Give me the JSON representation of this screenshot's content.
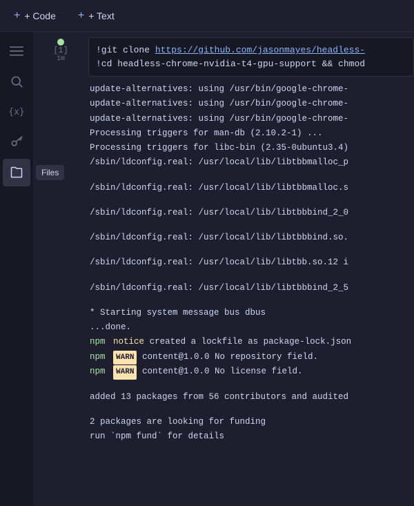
{
  "toolbar": {
    "code_btn": "+ Code",
    "text_btn": "+ Text"
  },
  "sidebar": {
    "icons": [
      {
        "name": "menu-icon",
        "label": "Menu",
        "symbol": "☰",
        "active": false
      },
      {
        "name": "search-icon",
        "label": "Search",
        "symbol": "🔍",
        "active": false
      },
      {
        "name": "variables-icon",
        "label": "Variables",
        "symbol": "{x}",
        "active": false
      },
      {
        "name": "secrets-icon",
        "label": "Secrets",
        "symbol": "🔑",
        "active": false
      },
      {
        "name": "files-icon",
        "label": "Files",
        "symbol": "📁",
        "active": true,
        "tooltip": "Files"
      }
    ]
  },
  "cell": {
    "number": "[1]",
    "time": "1m",
    "run_dot_color": "#a6e3a1",
    "input_lines": [
      "!git clone https://github.com/jasonmayes/headless-",
      "!cd headless-chrome-nvidia-t4-gpu-support && chmod"
    ],
    "link_text": "https://github.com/jasonmayes/headless-",
    "output_lines": [
      {
        "text": "update-alternatives: using /usr/bin/google-chrome-",
        "type": "normal"
      },
      {
        "text": "update-alternatives: using /usr/bin/google-chrome-",
        "type": "normal"
      },
      {
        "text": "update-alternatives: using /usr/bin/google-chrome-",
        "type": "normal"
      },
      {
        "text": "Processing triggers for man-db (2.10.2-1) ...",
        "type": "normal"
      },
      {
        "text": "Processing triggers for libc-bin (2.35-0ubuntu3.4)",
        "type": "normal"
      },
      {
        "text": "/sbin/ldconfig.real: /usr/local/lib/libtbbmalloc_p",
        "type": "normal"
      },
      {
        "text": "",
        "type": "empty"
      },
      {
        "text": "/sbin/ldconfig.real: /usr/local/lib/libtbbmalloc.s",
        "type": "normal"
      },
      {
        "text": "",
        "type": "empty"
      },
      {
        "text": "/sbin/ldconfig.real: /usr/local/lib/libtbbbind_2_0",
        "type": "normal"
      },
      {
        "text": "",
        "type": "empty"
      },
      {
        "text": "/sbin/ldconfig.real: /usr/local/lib/libtbbbind.so.",
        "type": "normal"
      },
      {
        "text": "",
        "type": "empty"
      },
      {
        "text": "/sbin/ldconfig.real: /usr/local/lib/libtbb.so.12 i",
        "type": "normal"
      },
      {
        "text": "",
        "type": "empty"
      },
      {
        "text": "/sbin/ldconfig.real: /usr/local/lib/libtbbbind_2_5",
        "type": "normal"
      },
      {
        "text": "",
        "type": "empty"
      },
      {
        "text": " * Starting system message bus dbus",
        "type": "star"
      },
      {
        "text": "    ...done.",
        "type": "normal"
      },
      {
        "text": "npm  notice  created a lockfile as package-lock.json",
        "type": "notice",
        "prefix": "npm",
        "badge": null,
        "notice": "notice"
      },
      {
        "text": "npm  WARN  content@1.0.0 No repository field.",
        "type": "warn",
        "prefix": "npm",
        "badge": "WARN",
        "rest": "content@1.0.0 No repository field."
      },
      {
        "text": "npm  WARN  content@1.0.0 No license field.",
        "type": "warn",
        "prefix": "npm",
        "badge": "WARN",
        "rest": "content@1.0.0 No license field."
      },
      {
        "text": "",
        "type": "empty"
      },
      {
        "text": "added 13 packages from 56 contributors and audited",
        "type": "normal"
      },
      {
        "text": "",
        "type": "empty"
      },
      {
        "text": "2 packages are looking for funding",
        "type": "normal"
      },
      {
        "text": "  run `npm fund` for details",
        "type": "normal"
      }
    ]
  }
}
